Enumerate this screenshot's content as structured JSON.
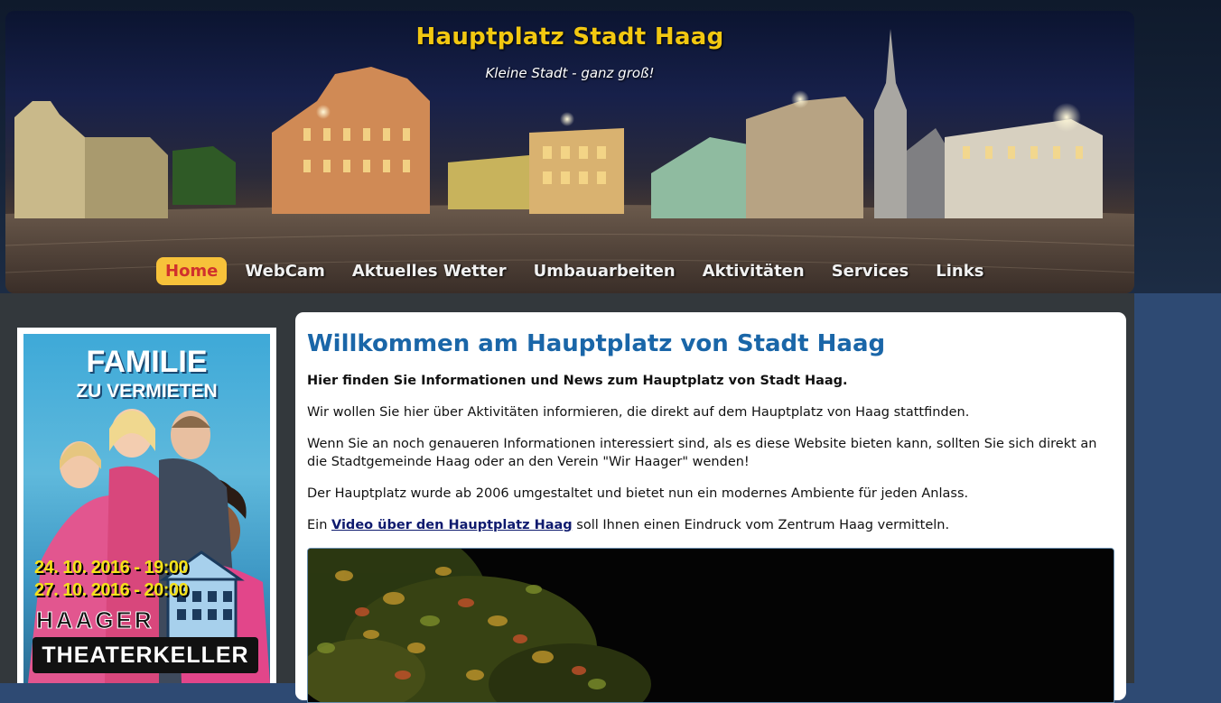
{
  "header": {
    "title": "Hauptplatz Stadt Haag",
    "slogan": "Kleine Stadt - ganz groß!"
  },
  "nav": {
    "items": [
      "Home",
      "WebCam",
      "Aktuelles Wetter",
      "Umbauarbeiten",
      "Aktivitäten",
      "Services",
      "Links"
    ],
    "active": "Home"
  },
  "sidebar": {
    "poster": {
      "title_line1": "FAMILIE",
      "title_line2": "ZU VERMIETEN",
      "date1": "24. 10. 2016 - 19:00",
      "date2": "27. 10. 2016 - 20:00",
      "venue_line1": "HAAGER",
      "venue_line2": "THEATERKELLER"
    }
  },
  "main": {
    "heading": "Willkommen am Hauptplatz von Stadt Haag",
    "intro": "Hier finden Sie Informationen und News zum Hauptplatz von Stadt Haag.",
    "p1": "Wir wollen Sie hier über Aktivitäten informieren, die direkt auf dem Hauptplatz von Haag stattfinden.",
    "p2": "Wenn Sie an noch genaueren Informationen interessiert sind, als es diese Website bieten kann, sollten Sie sich direkt an die Stadtgemeinde Haag oder an den Verein \"Wir Haager\" wenden!",
    "p3": "Der Hauptplatz wurde ab 2006 umgestaltet und bietet nun ein modernes Ambiente für jeden Anlass.",
    "p4_before": "Ein ",
    "p4_link": "Video über den Hauptplatz Haag",
    "p4_after": " soll Ihnen einen Eindruck vom Zentrum Haag vermitteln."
  },
  "colors": {
    "page_background": "#2e4a73",
    "title_yellow": "#f2c811",
    "heading_blue": "#1a66a8",
    "active_nav_bg": "#f7c23a",
    "active_nav_text": "#d0312d"
  }
}
